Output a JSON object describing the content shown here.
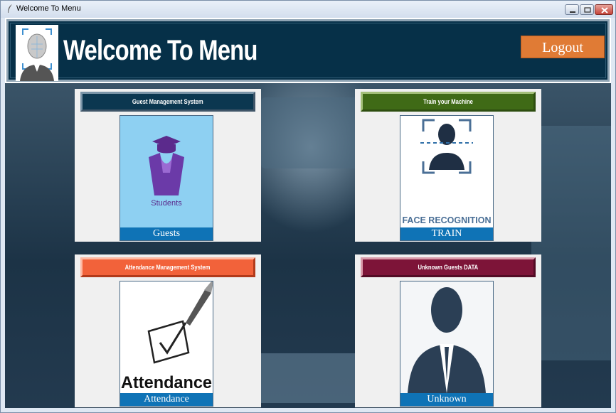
{
  "window": {
    "title": "Welcome To Menu",
    "icon": "feather-icon"
  },
  "header": {
    "title": "Welcome To Menu",
    "logout_label": "Logout",
    "logo_icon": "face-scan-icon"
  },
  "cards": [
    {
      "banner": "Guest Management System",
      "banner_color": "#0b3750",
      "image_text": "Students",
      "caption": "Guests"
    },
    {
      "banner": "Train your Machine",
      "banner_color": "#3f6a16",
      "image_text": "FACE RECOGNITION",
      "caption": "TRAIN"
    },
    {
      "banner": "Attendance Management System",
      "banner_color": "#f2623a",
      "image_text": "Attendance",
      "caption": "Attendance"
    },
    {
      "banner": "Unknown Guests DATA",
      "banner_color": "#7d1438",
      "image_text": "",
      "caption": "Unknown"
    }
  ],
  "colors": {
    "header_bg": "#063048",
    "logout_bg": "#e07b35",
    "caption_bg": "#0f73b6"
  }
}
